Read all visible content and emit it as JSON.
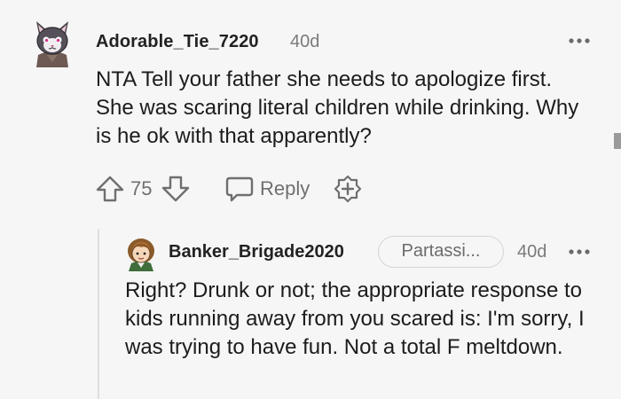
{
  "comment": {
    "username": "Adorable_Tie_7220",
    "age": "40d",
    "body": "NTA Tell your father she needs to apologize first. She was scaring literal children while drinking. Why is he ok with that apparently?",
    "votes": "75",
    "reply_label": "Reply",
    "icons": {
      "avatar": "cat-avatar-icon",
      "more": "more-dots-icon",
      "upvote": "upvote-arrow-icon",
      "downvote": "downvote-arrow-icon",
      "reply": "chat-bubble-icon",
      "award": "award-plus-icon"
    }
  },
  "reply": {
    "username": "Banker_Brigade2020",
    "flair": "Partassi...",
    "age": "40d",
    "body": "Right? Drunk or not; the appropriate response to kids running away from you scared is: I'm sorry, I was trying to have fun. Not a total F meltdown.",
    "icons": {
      "avatar": "cartoon-avatar-icon",
      "more": "more-dots-icon"
    }
  },
  "colors": {
    "background": "#f6f6f6",
    "text": "#1c1c1c",
    "meta": "#7a7a7a",
    "icon": "#6f6f6f"
  }
}
